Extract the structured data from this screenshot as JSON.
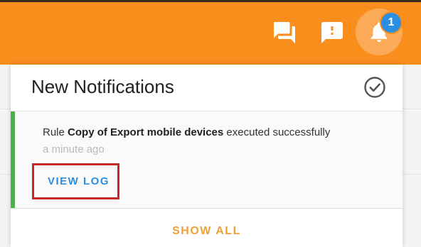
{
  "topbar": {
    "color": "#f98e1d",
    "icons": [
      "chat-icon",
      "feedback-icon",
      "bell-icon"
    ],
    "notification_count": "1"
  },
  "panel": {
    "title": "New Notifications",
    "mark_read_icon": "check-circle-icon",
    "notification": {
      "prefix": "Rule ",
      "rule_name": "Copy of Export mobile devices",
      "suffix": " executed successfully",
      "time": "a minute ago",
      "action_label": "VIEW LOG",
      "status_color": "#4caf50"
    },
    "show_all_label": "SHOW ALL"
  },
  "colors": {
    "accent_blue": "#2a8fe0",
    "highlight_box": "#c62828",
    "show_all": "#f0a03a"
  }
}
